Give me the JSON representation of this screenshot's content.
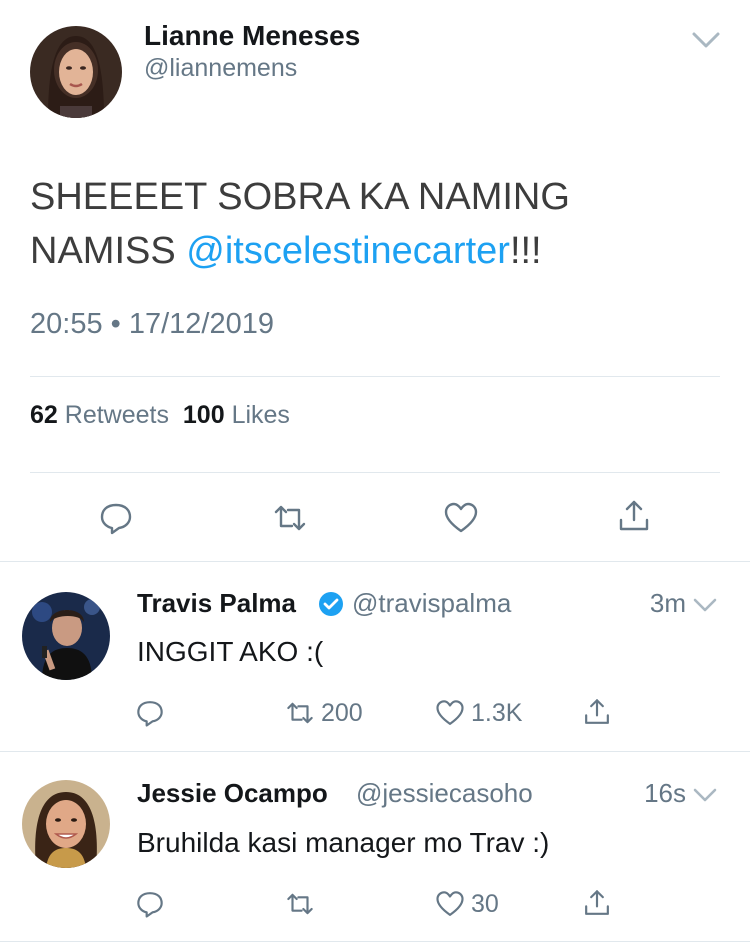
{
  "main_tweet": {
    "author_name": "Lianne Meneses",
    "author_handle": "@liannemens",
    "text_line1": "SHEEEET SOBRA KA NAMING",
    "text_line2_prefix": "NAMISS ",
    "mention": "@itscelestinecarter",
    "text_line2_suffix": "!!!",
    "timestamp": "20:55 • 17/12/2019",
    "retweets_count": "62",
    "retweets_label": "Retweets",
    "likes_count": "100",
    "likes_label": "Likes",
    "actions": [
      "reply-icon",
      "retweet-icon",
      "like-icon",
      "share-icon"
    ]
  },
  "replies": [
    {
      "name": "Travis Palma",
      "verified": true,
      "handle": "@travispalma",
      "time": "3m",
      "text": "INGGIT AKO :(",
      "retweets": "200",
      "likes": "1.3K"
    },
    {
      "name": "Jessie Ocampo",
      "verified": false,
      "handle": "@jessiecasoho",
      "time": "16s",
      "text": "Bruhilda kasi manager mo Trav :)",
      "retweets": "",
      "likes": "30"
    }
  ],
  "colors": {
    "accent": "#1da1f2",
    "muted": "#657786",
    "text": "#14171a",
    "divider": "#e1e8ed"
  }
}
